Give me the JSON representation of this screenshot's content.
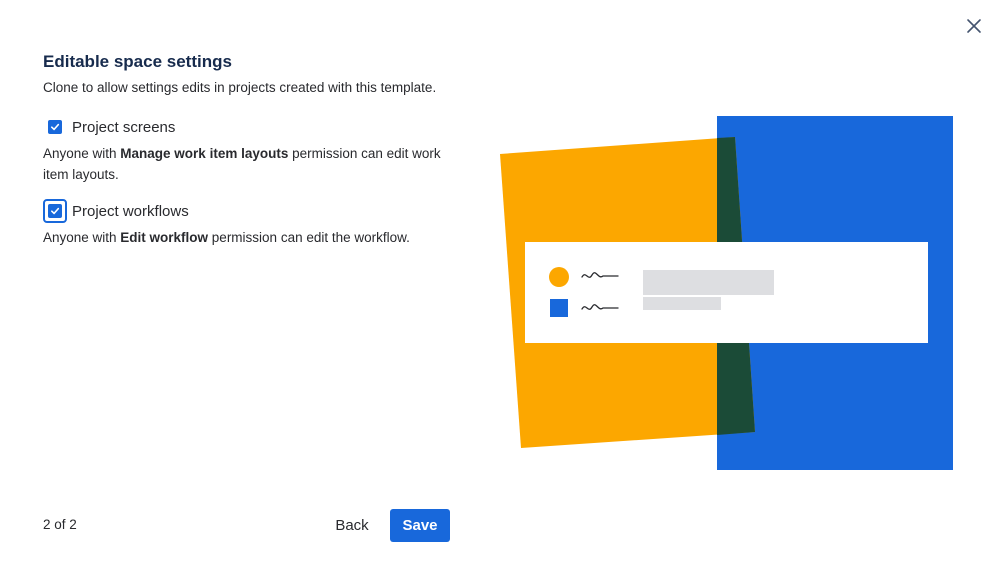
{
  "dialog": {
    "title": "Editable space settings",
    "subtitle": "Clone to allow settings edits in projects created with this template.",
    "close_icon": "close-icon"
  },
  "options": [
    {
      "label": "Project screens",
      "checked": true,
      "desc_prefix": "Anyone with ",
      "desc_bold": "Manage work item layouts",
      "desc_suffix": " permission can edit work item layouts."
    },
    {
      "label": "Project workflows",
      "checked": true,
      "focused": true,
      "desc_prefix": "Anyone with ",
      "desc_bold": "Edit workflow",
      "desc_suffix": " permission can edit the workflow."
    }
  ],
  "footer": {
    "step": "2 of 2",
    "back_label": "Back",
    "save_label": "Save"
  },
  "colors": {
    "accent": "#1868db",
    "illustration_yellow": "#fca700",
    "illustration_blue": "#1868db",
    "illustration_dark_green": "#1b4b37"
  }
}
